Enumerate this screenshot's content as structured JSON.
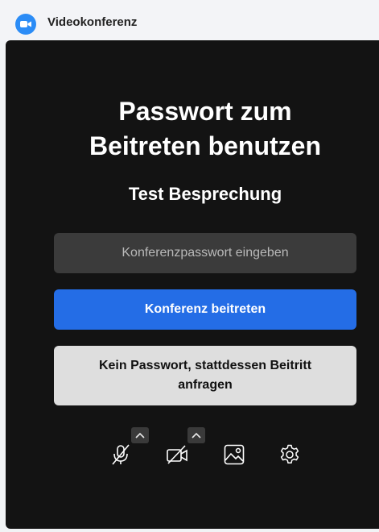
{
  "window": {
    "title": "Videokonferenz",
    "icon": "video-camera-icon"
  },
  "dialog": {
    "heading": "Passwort zum Beitreten benutzen",
    "meeting_name": "Test Besprechung",
    "password_placeholder": "Konferenzpasswort eingeben",
    "password_value": "",
    "join_label": "Konferenz beitreten",
    "request_label": "Kein Passwort, stattdessen Beitritt anfragen"
  },
  "toolbar": {
    "items": [
      {
        "name": "microphone-muted-icon",
        "has_options": true
      },
      {
        "name": "camera-off-icon",
        "has_options": true
      },
      {
        "name": "virtual-background-icon",
        "has_options": false
      },
      {
        "name": "settings-gear-icon",
        "has_options": false
      }
    ]
  },
  "colors": {
    "panel_bg": "#131313",
    "input_bg": "#3b3b3b",
    "primary": "#246de6",
    "secondary_bg": "#dedede",
    "app_icon": "#2b8cf6"
  }
}
